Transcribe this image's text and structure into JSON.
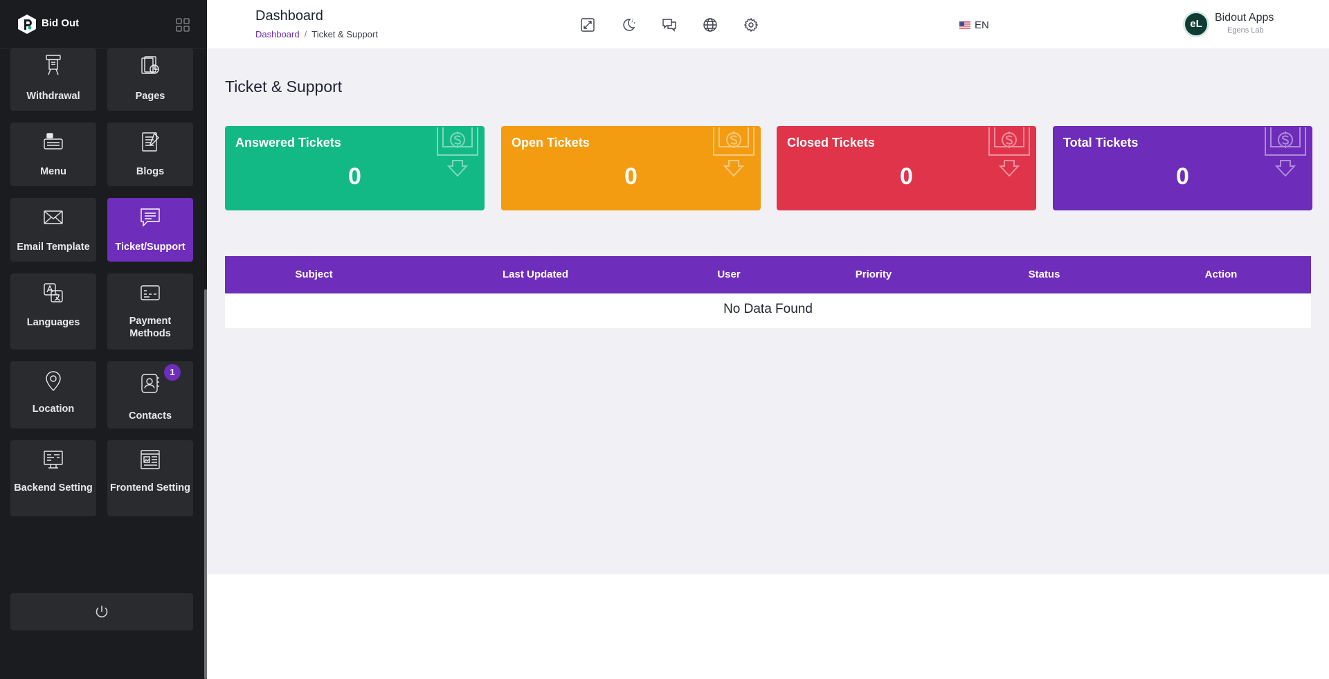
{
  "brand": {
    "name": "Bid Out"
  },
  "sidebar": {
    "items": [
      {
        "label": "Withdrawal",
        "icon": "atm-withdraw-icon"
      },
      {
        "label": "Pages",
        "icon": "pages-icon"
      },
      {
        "label": "Menu",
        "icon": "menu-icon"
      },
      {
        "label": "Blogs",
        "icon": "blog-icon"
      },
      {
        "label": "Email Template",
        "icon": "envelope-icon"
      },
      {
        "label": "Ticket/Support",
        "icon": "chat-icon",
        "active": true
      },
      {
        "label": "Languages",
        "icon": "translate-icon"
      },
      {
        "label": "Payment Methods",
        "icon": "payment-card-icon"
      },
      {
        "label": "Location",
        "icon": "map-pin-icon"
      },
      {
        "label": "Contacts",
        "icon": "contact-book-icon",
        "badge": "1"
      },
      {
        "label": "Backend Setting",
        "icon": "backend-monitor-icon"
      },
      {
        "label": "Frontend Setting",
        "icon": "frontend-browser-icon"
      }
    ],
    "power_icon": "power-icon"
  },
  "header": {
    "title": "Dashboard",
    "breadcrumb": {
      "home": "Dashboard",
      "separator": "/",
      "current": "Ticket & Support"
    },
    "tools": [
      "fullscreen-icon",
      "dark-mode-icon",
      "messages-icon",
      "globe-icon",
      "settings-gear-icon"
    ],
    "language": "EN",
    "user": {
      "name": "Bidout Apps",
      "org": "Egens Lab",
      "initials": "eL"
    }
  },
  "main": {
    "section_title": "Ticket & Support",
    "stats": [
      {
        "label": "Answered Tickets",
        "value": "0",
        "color": "#13b984"
      },
      {
        "label": "Open Tickets",
        "value": "0",
        "color": "#f39c12"
      },
      {
        "label": "Closed Tickets",
        "value": "0",
        "color": "#e0344b"
      },
      {
        "label": "Total Tickets",
        "value": "0",
        "color": "#6d2cb9"
      }
    ],
    "table": {
      "columns": [
        "Subject",
        "Last Updated",
        "User",
        "Priority",
        "Status",
        "Action"
      ],
      "empty_text": "No Data Found",
      "header_color": "#6e2dbb"
    }
  },
  "colors": {
    "accent": "#6e2dbb",
    "sidebar_bg": "#1b1c1f",
    "tile_bg": "#2a2b2e",
    "page_bg": "#f0f0f5"
  }
}
